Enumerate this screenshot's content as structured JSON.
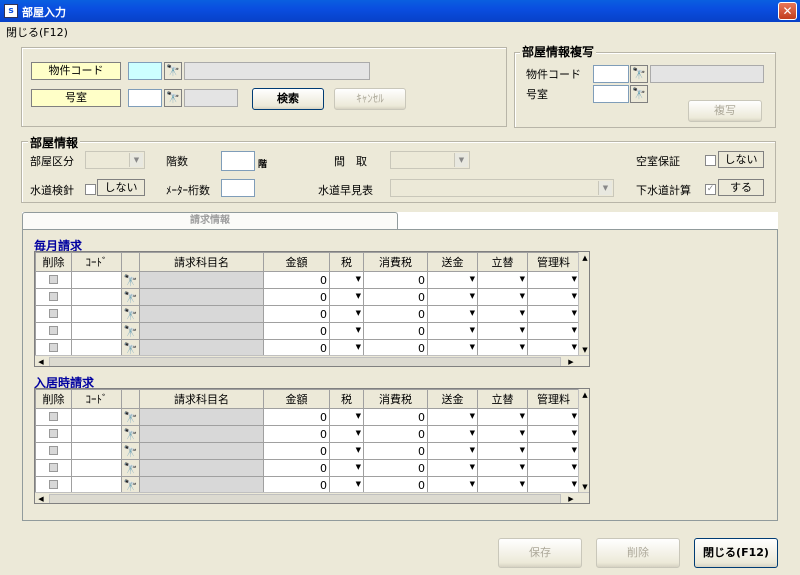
{
  "window": {
    "title": "部屋入力",
    "app_icon": "app-icon",
    "close": "✕"
  },
  "menu": {
    "close_label": "閉じる(F12)"
  },
  "search": {
    "property_code_label": "物件コード",
    "room_label": "号室",
    "search_button": "検索",
    "cancel_button": "ｷｬﾝｾﾙ",
    "binoculars": "🔭"
  },
  "copy_group": {
    "title": "部屋情報複写",
    "property_code_label": "物件コード",
    "room_label": "号室",
    "copy_button": "複写"
  },
  "room_info": {
    "title": "部屋情報",
    "room_type_label": "部屋区分",
    "floor_label": "階数",
    "floor_unit": "階",
    "layout_label": "間　取",
    "vacancy_label": "空室保証",
    "vacancy_value": "しない",
    "water_meter_label": "水道検針",
    "water_meter_value": "しない",
    "meter_digits_label": "ﾒｰﾀｰ桁数",
    "water_table_label": "水道早見表",
    "sewer_label": "下水道計算",
    "sewer_value": "する"
  },
  "tab": {
    "label": "請求情報"
  },
  "monthly": {
    "title": "毎月請求",
    "headers": [
      "削除",
      "ｺｰﾄﾞ",
      "",
      "請求科目名",
      "金額",
      "税",
      "消費税",
      "送金",
      "立替",
      "管理料"
    ],
    "rows": [
      {
        "amount": "0",
        "tax": "0"
      },
      {
        "amount": "0",
        "tax": "0"
      },
      {
        "amount": "0",
        "tax": "0"
      },
      {
        "amount": "0",
        "tax": "0"
      },
      {
        "amount": "0",
        "tax": "0"
      }
    ]
  },
  "movein": {
    "title": "入居時請求",
    "headers": [
      "削除",
      "ｺｰﾄﾞ",
      "",
      "請求科目名",
      "金額",
      "税",
      "消費税",
      "送金",
      "立替",
      "管理料"
    ],
    "rows": [
      {
        "amount": "0",
        "tax": "0"
      },
      {
        "amount": "0",
        "tax": "0"
      },
      {
        "amount": "0",
        "tax": "0"
      },
      {
        "amount": "0",
        "tax": "0"
      },
      {
        "amount": "0",
        "tax": "0"
      }
    ]
  },
  "footer": {
    "save_button": "保存",
    "delete_button": "削除",
    "close_button": "閉じる(F12)"
  }
}
